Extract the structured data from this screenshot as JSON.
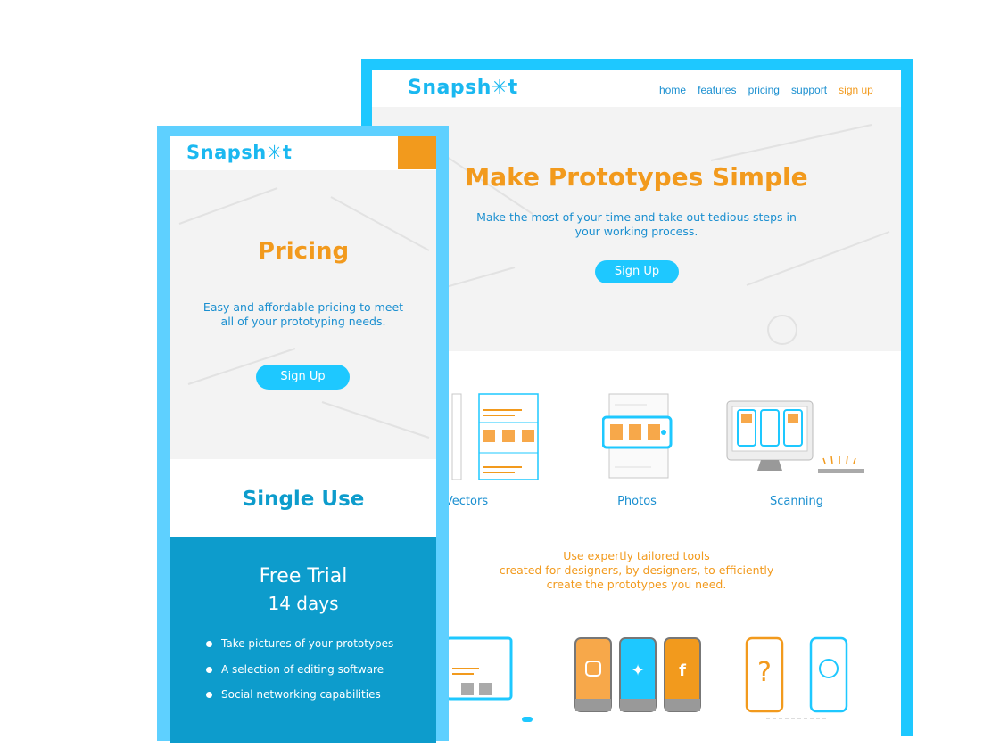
{
  "desktop": {
    "logo": "Snapsh✳t",
    "nav": [
      "home",
      "features",
      "pricing",
      "support",
      "sign up"
    ],
    "hero": {
      "title": "Make Prototypes Simple",
      "subtitle_line1": "Make the most of your time and take out tedious steps in",
      "subtitle_line2": "your working process.",
      "button": "Sign Up"
    },
    "features": [
      "Vectors",
      "Photos",
      "Scanning"
    ],
    "tagline_line1": "Use expertly tailored tools",
    "tagline_line2": "created for designers, by designers, to efficiently",
    "tagline_line3": "create the prototypes you need."
  },
  "mobile": {
    "logo": "Snapsh✳t",
    "hero": {
      "title": "Pricing",
      "desc_line1": "Easy and affordable pricing to meet",
      "desc_line2": "all of your prototyping needs.",
      "button": "Sign Up"
    },
    "plan_title": "Single Use",
    "trial_title": "Free Trial",
    "trial_days": "14 days",
    "features": [
      "Take pictures of your prototypes",
      "A selection of editing software",
      "Social networking capabilities"
    ]
  },
  "colors": {
    "brand_blue": "#1ec8ff",
    "orange": "#f29a1d",
    "dark_blue": "#0d9ccc"
  }
}
